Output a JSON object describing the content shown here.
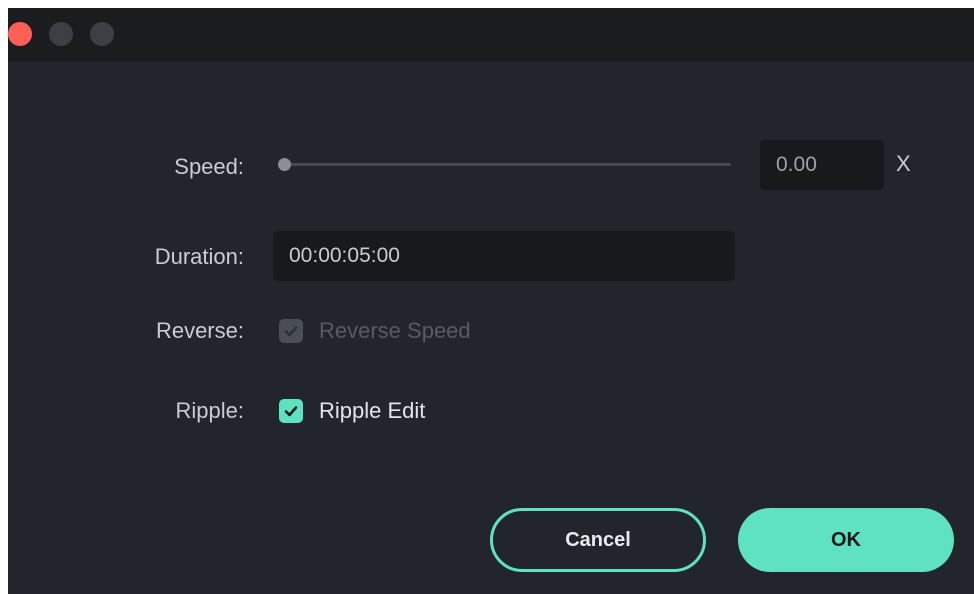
{
  "dialog": {
    "speed": {
      "label": "Speed:",
      "value": "0.00",
      "unit": "X",
      "slider_level": 0
    },
    "duration": {
      "label": "Duration:",
      "value": "00:00:05:00"
    },
    "reverse": {
      "label": "Reverse:",
      "checkbox_label": "Reverse Speed",
      "checked": true,
      "enabled": false
    },
    "ripple": {
      "label": "Ripple:",
      "checkbox_label": "Ripple Edit",
      "checked": true,
      "enabled": true
    },
    "buttons": {
      "cancel": "Cancel",
      "ok": "OK"
    }
  },
  "colors": {
    "accent": "#5ee2c2",
    "close_button": "#fe5f57",
    "background": "#22252c"
  },
  "icons": [
    "close-dot-icon",
    "minimize-dot-icon",
    "maximize-dot-icon",
    "checkmark-icon"
  ]
}
